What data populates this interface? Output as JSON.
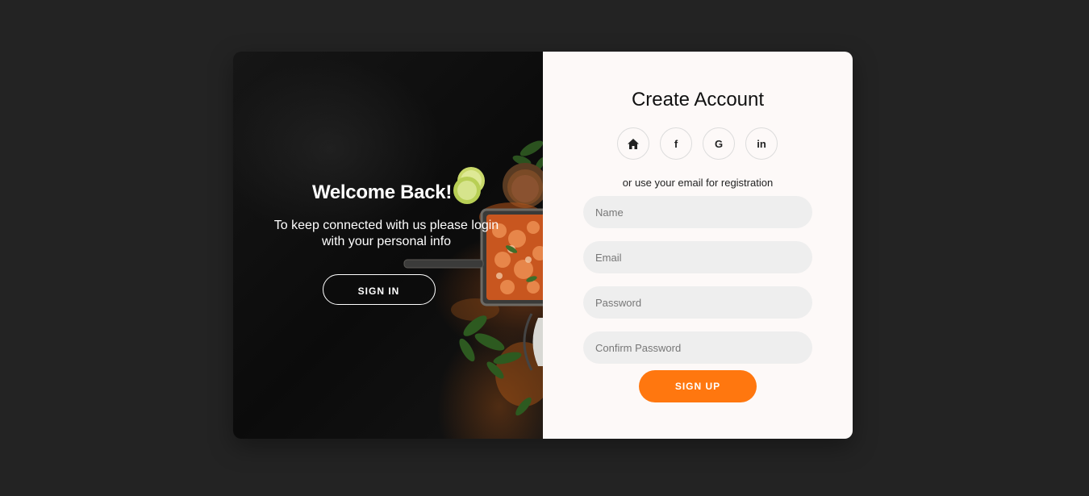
{
  "colors": {
    "page_bg": "#232323",
    "right_panel_bg": "#fdf9f8",
    "input_bg": "#eeeeee",
    "accent": "#ff770f"
  },
  "welcome": {
    "title": "Welcome Back!",
    "text": "To keep connected with us please login with your personal info",
    "signin_label": "SIGN IN",
    "background_icon": "food-photo"
  },
  "register": {
    "title": "Create Account",
    "socials": [
      {
        "icon": "home-icon"
      },
      {
        "icon": "facebook-icon",
        "glyph": "f"
      },
      {
        "icon": "google-icon",
        "glyph": "G"
      },
      {
        "icon": "linkedin-icon",
        "glyph": "in"
      }
    ],
    "or_text": "or use your email for registration",
    "fields": {
      "name_placeholder": "Name",
      "email_placeholder": "Email",
      "password_placeholder": "Password",
      "confirm_placeholder": "Confirm Password"
    },
    "signup_label": "SIGN UP"
  }
}
